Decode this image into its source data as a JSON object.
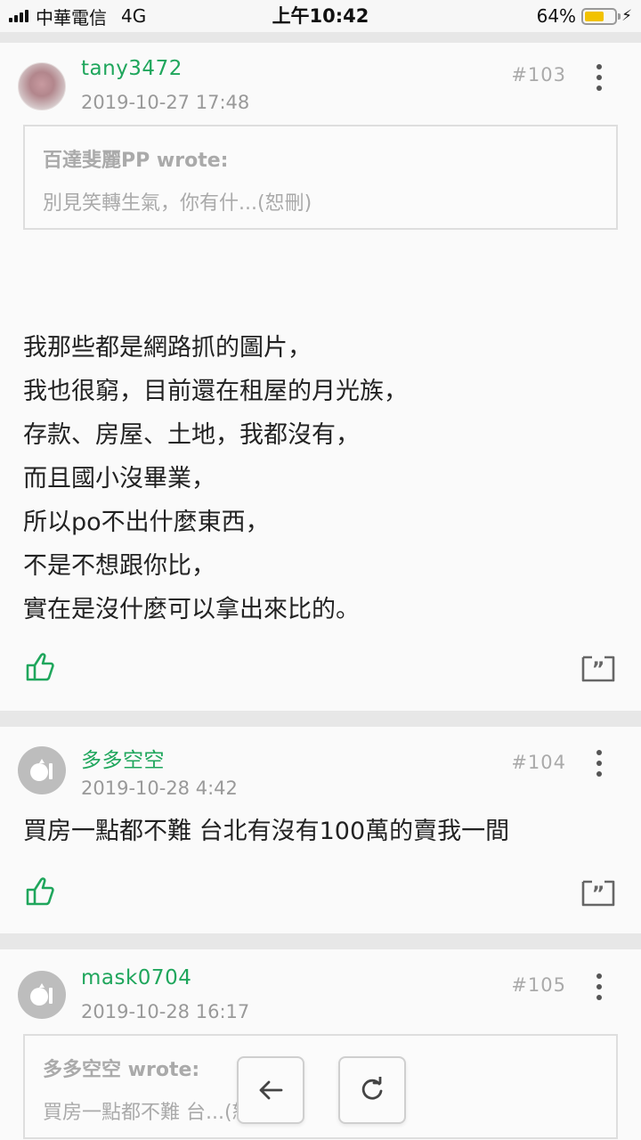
{
  "status_bar": {
    "carrier": "中華電信",
    "network": "4G",
    "time": "上午10:42",
    "battery_percent": "64%",
    "battery_level": 0.64
  },
  "posts": [
    {
      "username": "tany3472",
      "datetime": "2019-10-27 17:48",
      "floor": "#103",
      "avatar": "photo-avatar",
      "quote": {
        "author": "百達斐麗PP wrote:",
        "text": "別見笑轉生氣，你有什...(恕刪)"
      },
      "body_lines": [
        "我那些都是網路抓的圖片，",
        "我也很窮，目前還在租屋的月光族，",
        "存款、房屋、土地，我都沒有，",
        "而且國小沒畢業，",
        "所以po不出什麼東西，",
        "不是不想跟你比，",
        "實在是沒什麼可以拿出來比的。"
      ]
    },
    {
      "username": "多多空空",
      "datetime": "2019-10-28 4:42",
      "floor": "#104",
      "avatar": "default-avatar",
      "body_lines": [
        "買房一點都不難 台北有沒有100萬的賣我一間"
      ]
    },
    {
      "username": "mask0704",
      "datetime": "2019-10-28 16:17",
      "floor": "#105",
      "avatar": "default-avatar",
      "quote": {
        "author": "多多空空 wrote:",
        "text": "買房一點都不難 台...(恕刪)"
      }
    }
  ],
  "icons": {
    "like": "thumbs-up-icon",
    "reply": "quote-reply-icon",
    "more": "more-vertical-icon",
    "back": "arrow-left-icon",
    "refresh": "refresh-icon"
  },
  "colors": {
    "accent_green": "#1fa65c",
    "battery_yellow": "#f2c200"
  }
}
